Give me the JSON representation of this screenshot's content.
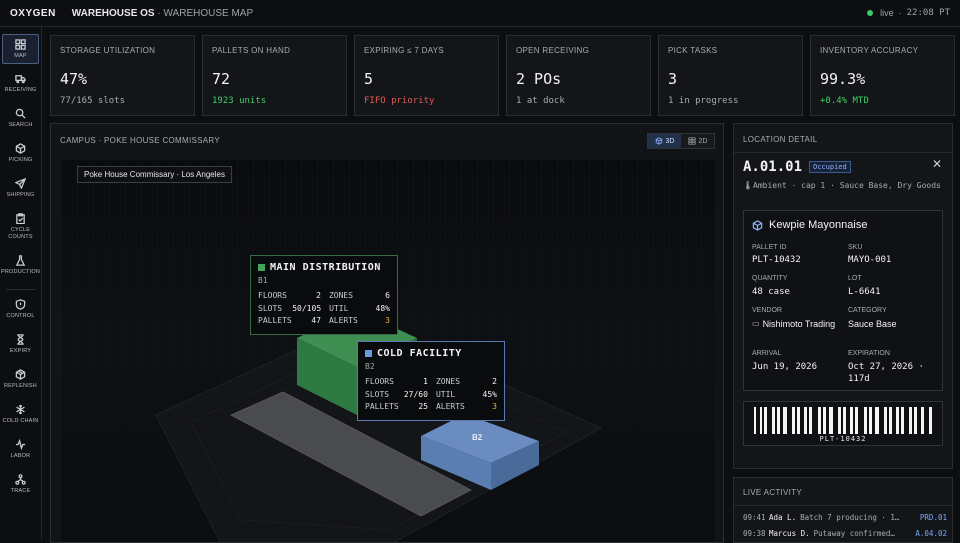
{
  "brand": "OXYGEN",
  "breadcrumb": {
    "app": "WAREHOUSE OS",
    "sep": " · ",
    "page": "WAREHOUSE MAP"
  },
  "status": {
    "state": "live",
    "sep": "·",
    "time": "22:08 PT",
    "color": "#39c96b"
  },
  "nav": [
    {
      "id": "map",
      "label": "MAP",
      "icon": "grid-icon"
    },
    {
      "id": "receiving",
      "label": "RECEIVING",
      "icon": "truck-icon"
    },
    {
      "id": "search",
      "label": "SEARCH",
      "icon": "search-icon"
    },
    {
      "id": "picking",
      "label": "PICKING",
      "icon": "box-icon"
    },
    {
      "id": "shipping",
      "label": "SHIPPING",
      "icon": "send-icon"
    },
    {
      "id": "cycle",
      "label": "CYCLE COUNTS",
      "icon": "clipboard-icon"
    },
    {
      "id": "production",
      "label": "PRODUCTION",
      "icon": "flask-icon"
    },
    {
      "id": "control",
      "label": "CONTROL",
      "icon": "shield-icon"
    },
    {
      "id": "expiry",
      "label": "EXPIRY",
      "icon": "hourglass-icon"
    },
    {
      "id": "replenish",
      "label": "REPLENISH",
      "icon": "package-icon"
    },
    {
      "id": "coldchain",
      "label": "COLD CHAIN",
      "icon": "snowflake-icon"
    },
    {
      "id": "labor",
      "label": "LABOR",
      "icon": "pulse-icon"
    },
    {
      "id": "trace",
      "label": "TRACE",
      "icon": "network-icon"
    }
  ],
  "stats": [
    {
      "title": "STORAGE UTILIZATION",
      "value": "47%",
      "sub": "77/165 slots",
      "sub_color": "#a7abb1"
    },
    {
      "title": "PALLETS ON HAND",
      "value": "72",
      "sub": "1923 units",
      "sub_color": "#3fcf6b"
    },
    {
      "title": "EXPIRING ≤ 7 DAYS",
      "value": "5",
      "sub": "FIFO priority",
      "sub_color": "#e05a52"
    },
    {
      "title": "OPEN RECEIVING",
      "value": "2 POs",
      "sub": "1 at dock",
      "sub_color": "#a7abb1"
    },
    {
      "title": "PICK TASKS",
      "value": "3",
      "sub": "1 in progress",
      "sub_color": "#a7abb1"
    },
    {
      "title": "INVENTORY ACCURACY",
      "value": "99.3%",
      "sub": "+0.4% MTD",
      "sub_color": "#3fcf6b"
    }
  ],
  "map": {
    "title": "CAMPUS · POKE HOUSE COMMISSARY",
    "view_3d": "3D",
    "view_2d": "2D",
    "place": "Poke House Commissary · Los Angeles",
    "b2_label": "B2",
    "buildings": [
      {
        "name": "MAIN DISTRIBUTION",
        "code": "B1",
        "color": "#3fa65b",
        "floors_label": "FLOORS",
        "floors": "2",
        "zones_label": "ZONES",
        "zones": "6",
        "slots_label": "SLOTS",
        "slots": "50/105",
        "util_label": "UTIL",
        "util": "48%",
        "pallets_label": "PALLETS",
        "pallets": "47",
        "alerts_label": "ALERTS",
        "alerts": "3"
      },
      {
        "name": "COLD FACILITY",
        "code": "B2",
        "color": "#6a9ae0",
        "floors_label": "FLOORS",
        "floors": "1",
        "zones_label": "ZONES",
        "zones": "2",
        "slots_label": "SLOTS",
        "slots": "27/60",
        "util_label": "UTIL",
        "util": "45%",
        "pallets_label": "PALLETS",
        "pallets": "25",
        "alerts_label": "ALERTS",
        "alerts": "3"
      }
    ]
  },
  "detail": {
    "title": "LOCATION DETAIL",
    "location": "A.01.01",
    "status": "Occupied",
    "meta": "Ambient · cap 1 · Sauce Base, Dry Goods",
    "product": "Kewpie Mayonnaise",
    "fields": {
      "pallet_id_label": "PALLET ID",
      "pallet_id": "PLT-10432",
      "sku_label": "SKU",
      "sku": "MAYO-001",
      "quantity_label": "QUANTITY",
      "quantity": "48 case",
      "lot_label": "LOT",
      "lot": "L-6641",
      "vendor_label": "VENDOR",
      "vendor": "Nishimoto Trading",
      "category_label": "CATEGORY",
      "category": "Sauce Base",
      "arrival_label": "ARRIVAL",
      "arrival": "Jun 19, 2026",
      "expiration_label": "EXPIRATION",
      "expiration": "Oct 27, 2026 · 117d"
    },
    "barcode_text": "PLT-10432"
  },
  "activity": {
    "title": "LIVE ACTIVITY",
    "rows": [
      {
        "time": "09:41",
        "who": "Ada L.",
        "msg": "Batch 7 producing · 1…",
        "tag": "PRD.01"
      },
      {
        "time": "09:38",
        "who": "Marcus D.",
        "msg": "Putaway confirmed…",
        "tag": "A.04.02"
      }
    ]
  }
}
